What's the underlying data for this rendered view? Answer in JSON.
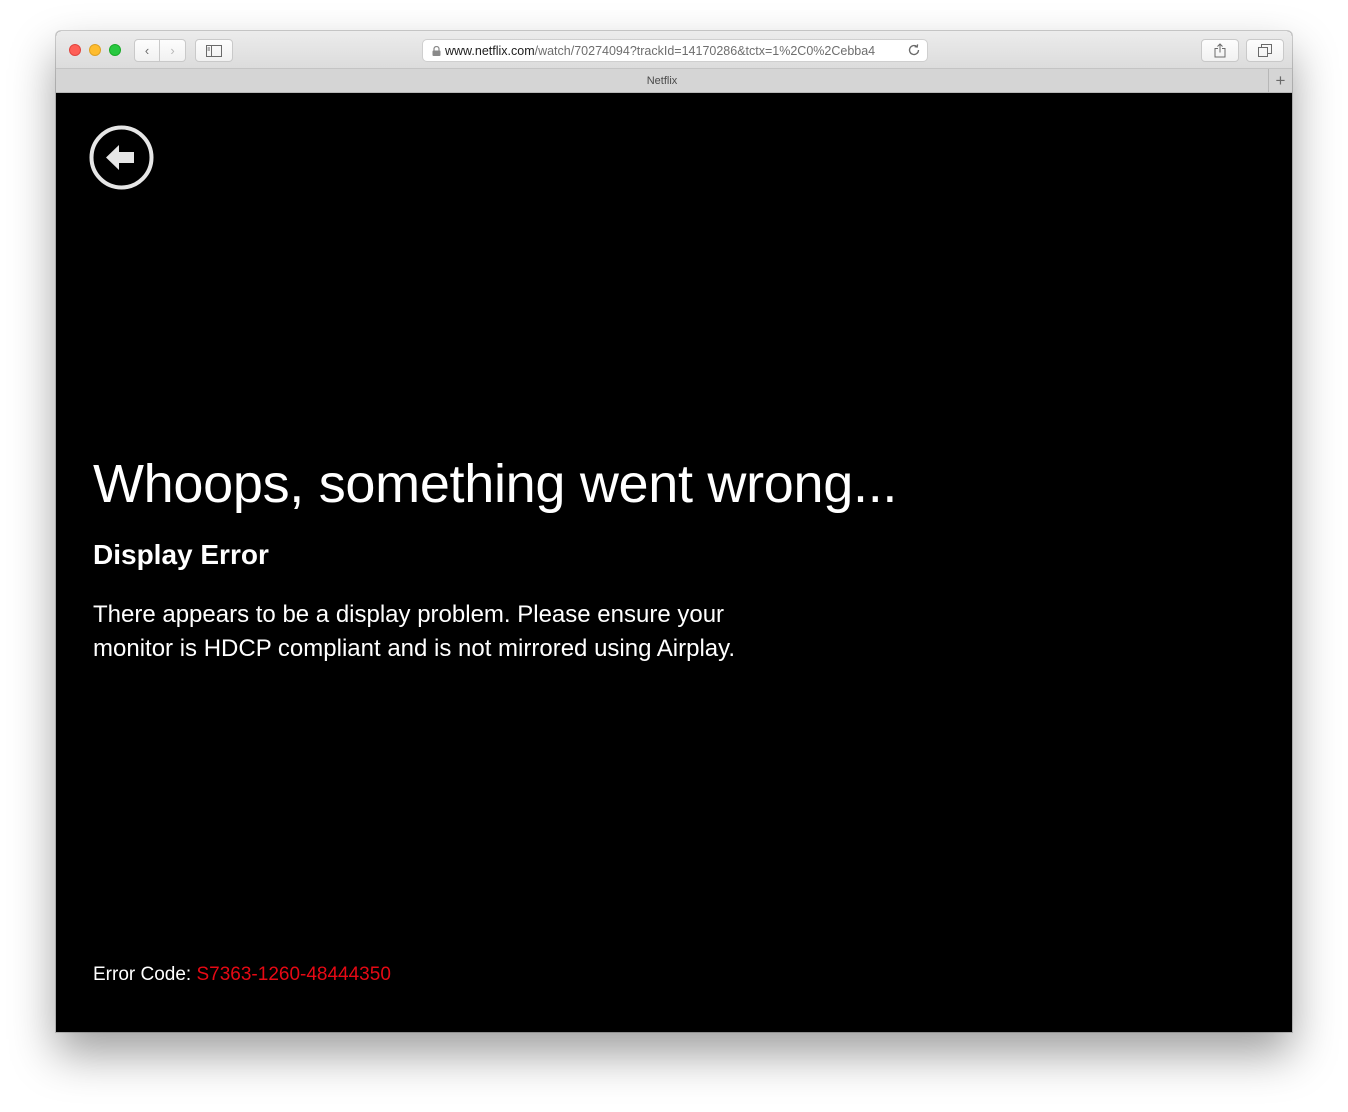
{
  "browser": {
    "url_host": "www.netflix.com",
    "url_path": "/watch/70274094?trackId=14170286&tctx=1%2C0%2Cebba4",
    "tab_title": "Netflix",
    "new_tab_label": "+",
    "back_label": "‹",
    "forward_label": "›",
    "icons": {
      "lock": "lock-icon",
      "reload": "reload-icon",
      "sidebar": "sidebar-icon",
      "share": "share-icon",
      "tabs": "tabs-overview-icon"
    }
  },
  "player": {
    "back_icon": "back-arrow-icon",
    "headline": "Whoops, something went wrong...",
    "error_title": "Display Error",
    "message": "There appears to be a display problem. Please ensure your monitor is HDCP compliant and is not mirrored using Airplay.",
    "error_code_label": "Error Code:",
    "error_code": "S7363-1260-48444350"
  },
  "colors": {
    "background": "#000000",
    "text": "#ffffff",
    "error_code": "#e50914"
  }
}
